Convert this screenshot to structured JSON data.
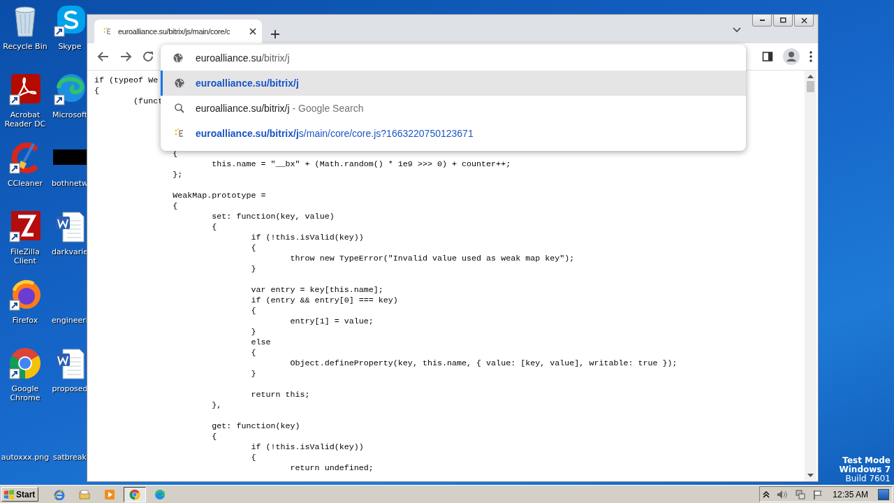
{
  "desktop": {
    "icons": [
      {
        "label": "Recycle Bin"
      },
      {
        "label": "Skype"
      },
      {
        "label": "Acrobat Reader DC"
      },
      {
        "label": "Microsoft"
      },
      {
        "label": "CCleaner"
      },
      {
        "label": "bothnetw"
      },
      {
        "label": "FileZilla Client"
      },
      {
        "label": "darkvarie"
      },
      {
        "label": "Firefox"
      },
      {
        "label": "engineeri"
      },
      {
        "label": "Google Chrome"
      },
      {
        "label": "proposed"
      },
      {
        "label": "autoxxx.png"
      },
      {
        "label": "satbreak"
      }
    ],
    "os_notice": [
      "Test Mode",
      "Windows 7",
      "Build 7601"
    ]
  },
  "browser": {
    "tab": {
      "title": "euroalliance.su/bitrix/js/main/core/c"
    },
    "omnibox": {
      "host": "euroalliance.su",
      "path": "/bitrix/j"
    },
    "suggestions": [
      {
        "kind": "url",
        "match": "euroalliance.su/bitrix/j",
        "selected": true
      },
      {
        "kind": "search",
        "match": "euroalliance.su/bitrix/j",
        "suffix": "- Google Search",
        "selected": false
      },
      {
        "kind": "page",
        "match": "euroalliance.su/bitrix/j",
        "rest": "s/main/core/core.js?1663220750123671",
        "selected": false
      }
    ],
    "code": {
      "blocks": [
        [
          "if (typeof We",
          "{",
          "\t(funct"
        ],
        [
          "\t\t{",
          "\t\t\tthis.name = \"__bx\" + (Math.random() * 1e9 >>> 0) + counter++;",
          "\t\t};"
        ],
        [
          "\t\tWeakMap.prototype =",
          "\t\t{",
          "\t\t\tset: function(key, value)",
          "\t\t\t{",
          "\t\t\t\tif (!this.isValid(key))",
          "\t\t\t\t{",
          "\t\t\t\t\tthrow new TypeError(\"Invalid value used as weak map key\");",
          "\t\t\t\t}"
        ],
        [
          "\t\t\t\tvar entry = key[this.name];",
          "\t\t\t\tif (entry && entry[0] === key)",
          "\t\t\t\t{",
          "\t\t\t\t\tentry[1] = value;",
          "\t\t\t\t}",
          "\t\t\t\telse",
          "\t\t\t\t{",
          "\t\t\t\t\tObject.defineProperty(key, this.name, { value: [key, value], writable: true });",
          "\t\t\t\t}"
        ],
        [
          "\t\t\t\treturn this;",
          "\t\t\t},"
        ],
        [
          "\t\t\tget: function(key)",
          "\t\t\t{",
          "\t\t\t\tif (!this.isValid(key))",
          "\t\t\t\t{",
          "\t\t\t\t\treturn undefined;"
        ]
      ]
    }
  },
  "taskbar": {
    "start": "Start",
    "items": [
      {
        "selected": false
      },
      {
        "selected": false
      },
      {
        "selected": false
      },
      {
        "selected": true
      },
      {
        "selected": false
      }
    ],
    "clock": "12:35 AM"
  }
}
